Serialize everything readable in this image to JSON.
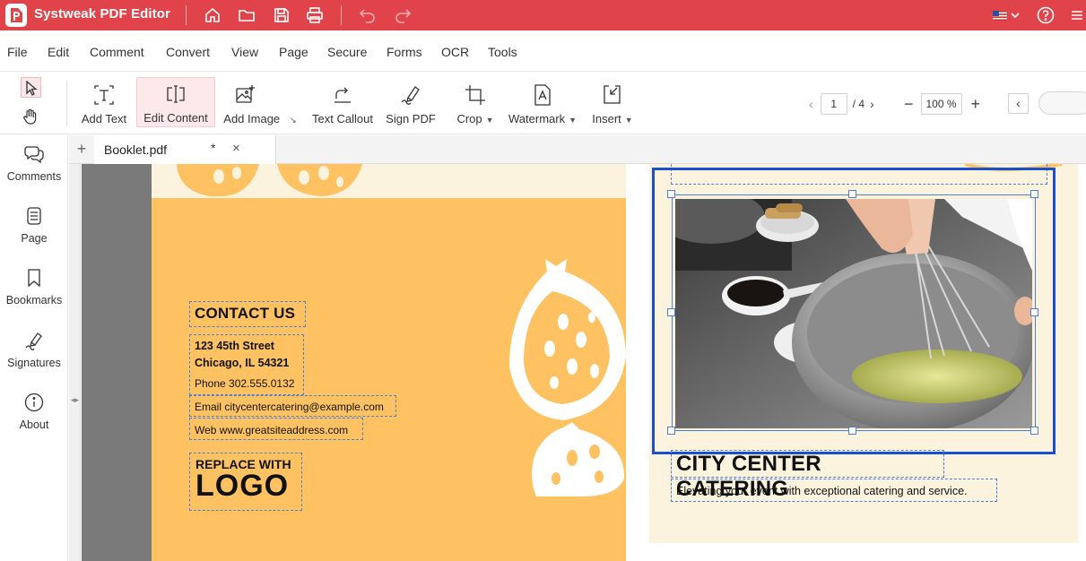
{
  "app": {
    "title": "Systweak PDF Editor",
    "brand_color": "#e0434a"
  },
  "titlebar_icons": [
    "home-icon",
    "folder-icon",
    "save-icon",
    "print-icon",
    "undo-icon",
    "redo-icon",
    "flag-us-icon",
    "help-icon",
    "menu-icon"
  ],
  "menu": [
    "File",
    "Edit",
    "Comment",
    "Convert",
    "View",
    "Page",
    "Secure",
    "Forms",
    "OCR",
    "Tools"
  ],
  "toolbar": {
    "add_text": "Add Text",
    "edit_content": "Edit Content",
    "add_image": "Add Image",
    "text_callout": "Text Callout",
    "sign_pdf": "Sign PDF",
    "crop": "Crop",
    "watermark": "Watermark",
    "insert": "Insert"
  },
  "pager": {
    "current_page": "1",
    "total": "/ 4",
    "zoom": "100 %"
  },
  "sidebar": {
    "comments": "Comments",
    "page": "Page",
    "bookmarks": "Bookmarks",
    "signatures": "Signatures",
    "about": "About"
  },
  "tab": {
    "name": "Booklet.pdf",
    "modified": "*",
    "close": "×",
    "add": "+"
  },
  "document": {
    "contact_title": "CONTACT US",
    "address_line1": "123 45th Street",
    "address_line2": "Chicago, IL 54321",
    "phone": "Phone 302.555.0132",
    "email": "Email citycentercatering@example.com",
    "web": "Web www.greatsiteaddress.com",
    "logo_line1": "REPLACE WITH",
    "logo_line2": "LOGO",
    "catering_title": "CITY CENTER CATERING",
    "catering_tagline": "Elevating your event with exceptional catering and service."
  }
}
